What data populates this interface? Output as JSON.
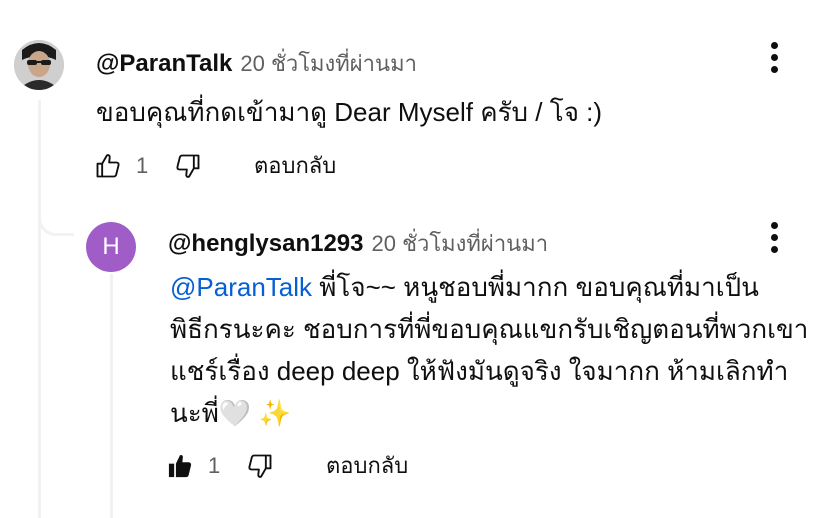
{
  "comments": [
    {
      "author": "@ParanTalk",
      "time": "20 ชั่วโมงที่ผ่านมา",
      "text": "ขอบคุณที่กดเข้ามาดู Dear Myself ครับ / โจ :)",
      "likes": "1",
      "reply_label": "ตอบกลับ",
      "avatar_icon": "profile-photo",
      "liked": false
    },
    {
      "author": "@henglysan1293",
      "time": "20 ชั่วโมงที่ผ่านมา",
      "avatar_letter": "H",
      "avatar_color": "#a05cc7",
      "mention": "@ParanTalk",
      "text_lines": [
        "พี่โจ~~ หนูชอบพี่มากก ขอบคุณที่มาเป็น",
        "พิธีกรนะคะ ชอบการที่พี่ขอบคุณแขกรับเชิญตอนที่พวกเขา",
        "แชร์เรื่อง deep deep ให้ฟังมันดูจริง ใจมากก ห้ามเลิกทำ",
        "นะพี่🤍 ✨"
      ],
      "likes": "1",
      "reply_label": "ตอบกลับ",
      "liked": true
    }
  ],
  "colors": {
    "link": "#065fd4",
    "muted": "#606060",
    "thread_line": "#f2f2f2"
  }
}
